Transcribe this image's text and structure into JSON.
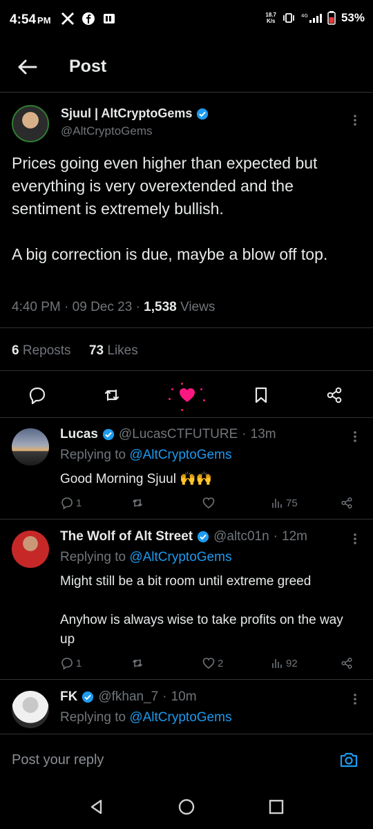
{
  "status_bar": {
    "time": "4:54",
    "ampm": "PM",
    "speed_top": "18.7",
    "speed_bottom": "K/s",
    "battery": "53%",
    "icons": [
      "x-logo-icon",
      "facebook-icon",
      "gallery-icon",
      "vibrate-icon",
      "4g-signal-icon",
      "battery-icon"
    ]
  },
  "header": {
    "title": "Post"
  },
  "main_tweet": {
    "name": "Sjuul | AltCryptoGems",
    "handle": "@AltCryptoGems",
    "text": "Prices going even higher than expected but everything is very overextended and the sentiment is extremely bullish.\n\nA big correction is due, maybe a blow off top.",
    "time": "4:40 PM",
    "date": "09 Dec 23",
    "views_count": "1,538",
    "views_label": "Views",
    "reposts_count": "6",
    "reposts_label": "Reposts",
    "likes_count": "73",
    "likes_label": "Likes",
    "like_color": "#f91880",
    "verified_color": "#1d9bf0"
  },
  "replies": [
    {
      "name": "Lucas",
      "handle": "@LucasCTFUTURE",
      "time": "13m",
      "replying_prefix": "Replying to ",
      "replying_to": "@AltCryptoGems",
      "text": "Good Morning Sjuul 🙌🙌",
      "reply_count": "1",
      "repost_count": "",
      "like_count": "",
      "view_count": "75"
    },
    {
      "name": "The Wolf of Alt Street",
      "handle": "@altc01n",
      "time": "12m",
      "replying_prefix": "Replying to ",
      "replying_to": "@AltCryptoGems",
      "text": "Might still be a bit room until extreme greed\n\nAnyhow is always wise to take profits on the way up",
      "reply_count": "1",
      "repost_count": "",
      "like_count": "2",
      "view_count": "92"
    },
    {
      "name": "FK",
      "handle": "@fkhan_7",
      "time": "10m",
      "replying_prefix": "Replying to ",
      "replying_to": "@AltCryptoGems"
    }
  ],
  "reply_bar": {
    "placeholder": "Post your reply"
  }
}
